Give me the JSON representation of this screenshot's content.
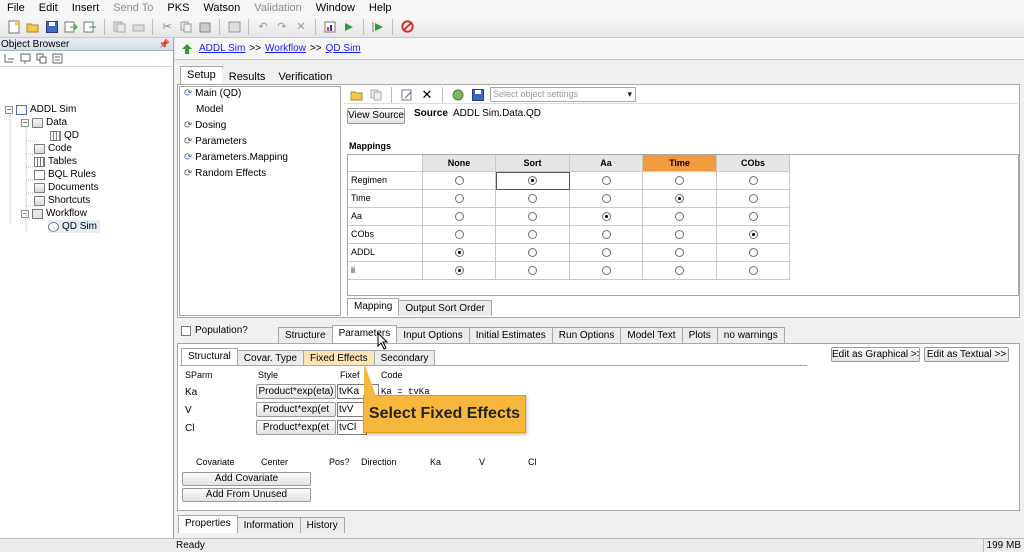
{
  "menu": [
    "File",
    "Edit",
    "Insert",
    "Send To",
    "PKS",
    "Watson",
    "Validation",
    "Window",
    "Help"
  ],
  "menu_disabled": [
    "Send To",
    "Validation"
  ],
  "object_browser": {
    "title": "Object Browser",
    "tree": [
      {
        "label": "ADDL Sim",
        "level": 0,
        "icon": "project-icon"
      },
      {
        "label": "Data",
        "level": 1,
        "icon": "data-folder-icon"
      },
      {
        "label": "QD",
        "level": 2,
        "icon": "table-icon"
      },
      {
        "label": "Code",
        "level": 1,
        "icon": "folder-icon"
      },
      {
        "label": "Tables",
        "level": 1,
        "icon": "tables-icon"
      },
      {
        "label": "BQL Rules",
        "level": 1,
        "icon": "rules-icon"
      },
      {
        "label": "Documents",
        "level": 1,
        "icon": "folder-icon"
      },
      {
        "label": "Shortcuts",
        "level": 1,
        "icon": "folder-icon"
      },
      {
        "label": "Workflow",
        "level": 1,
        "icon": "workflow-icon"
      },
      {
        "label": "QD Sim",
        "level": 2,
        "icon": "model-icon"
      }
    ]
  },
  "breadcrumb": [
    "ADDL Sim",
    "Workflow",
    "QD Sim"
  ],
  "breadcrumb_sep": ">>",
  "top_tabs": [
    "Setup",
    "Results",
    "Verification"
  ],
  "setup_list": [
    "Main (QD)",
    "Model",
    "Dosing",
    "Parameters",
    "Parameters.Mapping",
    "Random Effects"
  ],
  "object_settings_placeholder": "Select object settings",
  "view_source_label": "View Source",
  "source_label": "Source",
  "source_value": "ADDL Sim.Data.QD",
  "mappings": {
    "title": "Mappings",
    "columns": [
      "None",
      "Sort",
      "Aa",
      "Time",
      "CObs"
    ],
    "highlight_column": "Time",
    "rows": [
      {
        "name": "Regimen",
        "selected": 1
      },
      {
        "name": "Time",
        "selected": 3
      },
      {
        "name": "Aa",
        "selected": 2
      },
      {
        "name": "CObs",
        "selected": 4
      },
      {
        "name": "ADDL",
        "selected": 0
      },
      {
        "name": "ii",
        "selected": 0
      }
    ]
  },
  "mapping_tabs": [
    "Mapping",
    "Output Sort Order"
  ],
  "population_label": "Population?",
  "model_tabs": [
    "Structure",
    "Parameters",
    "Input Options",
    "Initial Estimates",
    "Run Options",
    "Model Text",
    "Plots",
    "no warnings"
  ],
  "param_tabs": [
    "Structural",
    "Covar. Type",
    "Fixed Effects",
    "Secondary"
  ],
  "edit_graphical": "Edit as Graphical >>",
  "edit_textual": "Edit as Textual >>",
  "param_table": {
    "headers": [
      "SParm",
      "Style",
      "Fixef",
      "Code"
    ],
    "rows": [
      {
        "name": "Ka",
        "style": "Product*exp(eta)",
        "fixef": "tvKa",
        "code": "Ka = tvKa"
      },
      {
        "name": "V",
        "style": "Product*exp(et",
        "fixef": "tvV",
        "code": ""
      },
      {
        "name": "Cl",
        "style": "Product*exp(et",
        "fixef": "tvCl",
        "code": ""
      }
    ]
  },
  "callout": "Select Fixed Effects",
  "covariate_headers": [
    "Covariate",
    "Center",
    "Pos?",
    "Direction",
    "Ka",
    "V",
    "Cl"
  ],
  "add_covariate": "Add Covariate",
  "add_from_unused": "Add From Unused",
  "bottom_tabs": [
    "Properties",
    "Information",
    "History"
  ],
  "status_left": "Ready",
  "status_right": "199 MB",
  "colors": {
    "highlight": "#f39a3d",
    "callout": "#f6b73c",
    "link": "#1a1aff"
  }
}
